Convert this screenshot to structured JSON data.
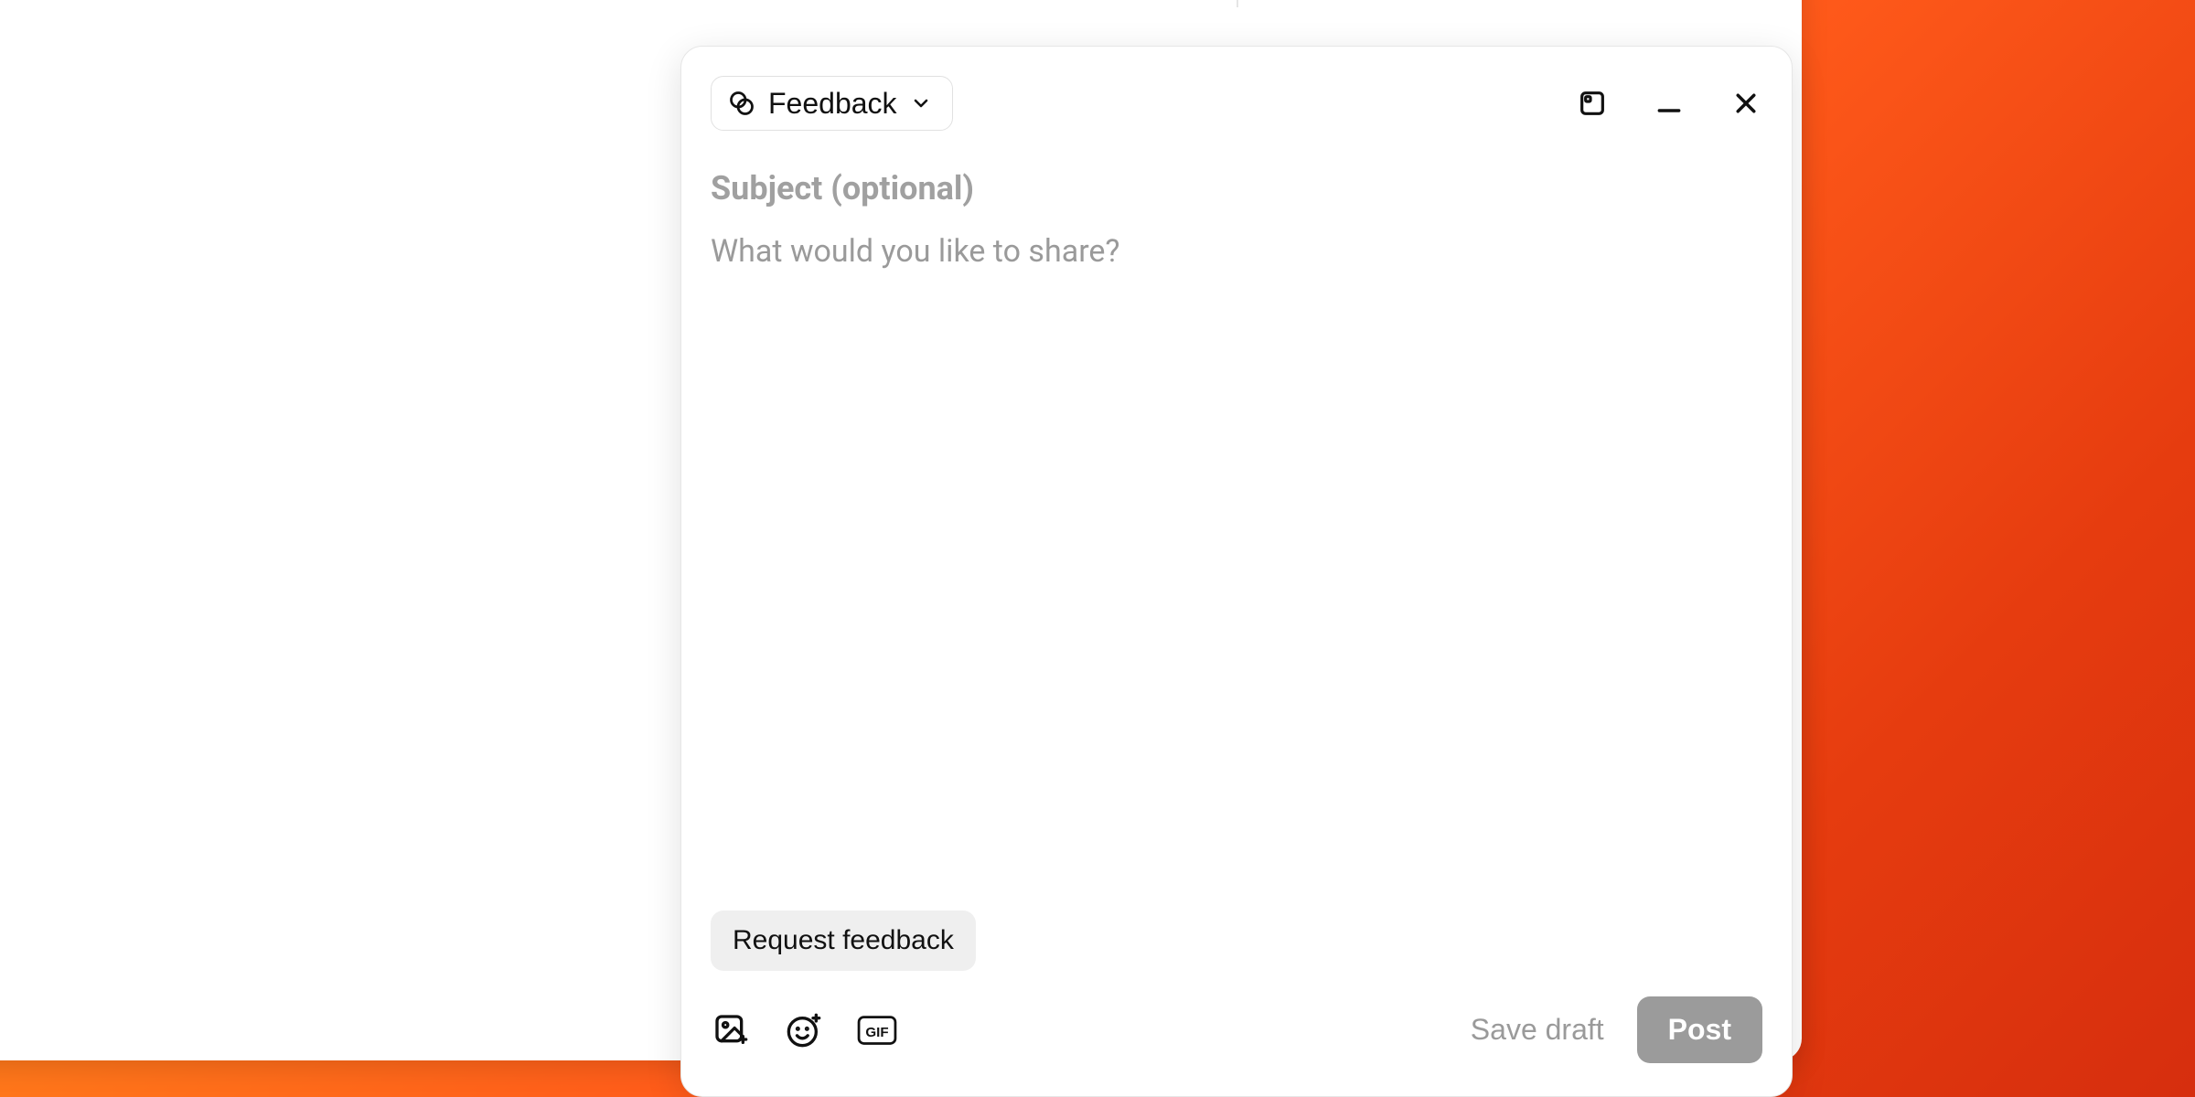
{
  "compose": {
    "category_label": "Feedback",
    "subject_placeholder": "Subject (optional)",
    "body_placeholder": "What would you like to share?",
    "request_feedback_label": "Request feedback",
    "save_draft_label": "Save draft",
    "post_label": "Post"
  }
}
